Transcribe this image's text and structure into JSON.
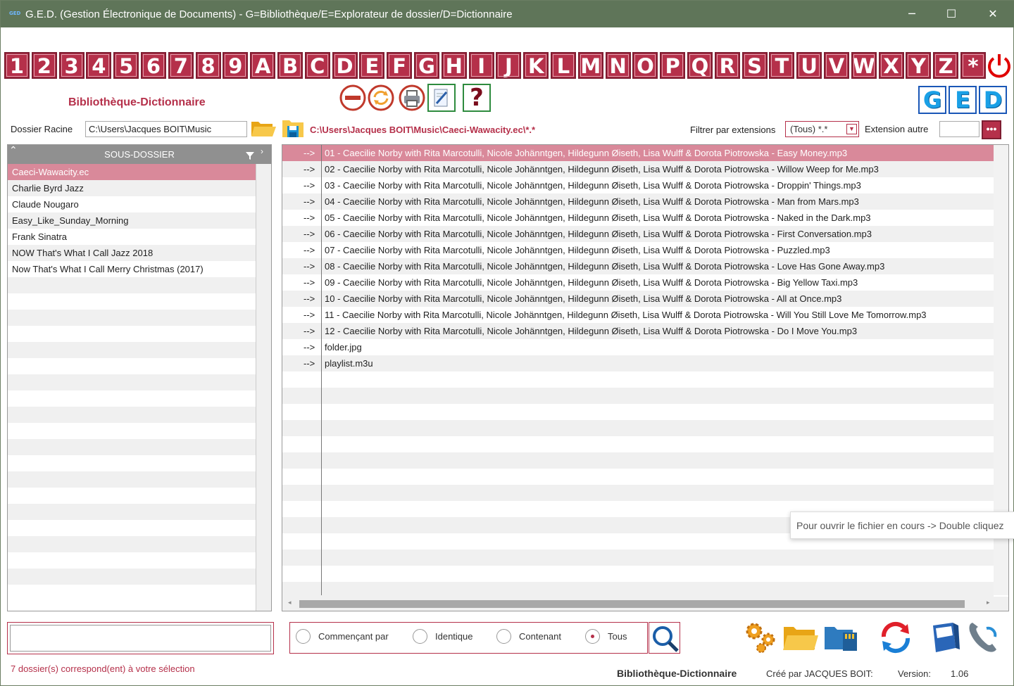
{
  "window": {
    "title": "G.E.D. (Gestion Électronique de Documents) - G=Bibliothèque/E=Explorateur de dossier/D=Dictionnaire",
    "app_icon_text": "GED",
    "minimize": "─",
    "maximize": "☐",
    "close": "✕"
  },
  "letters": [
    "1",
    "2",
    "3",
    "4",
    "5",
    "6",
    "7",
    "8",
    "9",
    "A",
    "B",
    "C",
    "D",
    "E",
    "F",
    "G",
    "H",
    "I",
    "J",
    "K",
    "L",
    "M",
    "N",
    "O",
    "P",
    "Q",
    "R",
    "S",
    "T",
    "U",
    "V",
    "W",
    "X",
    "Y",
    "Z",
    "*"
  ],
  "toolbar": {
    "section_title": "Bibliothèque-Dictionnaire",
    "help_label": "?",
    "ged": [
      "G",
      "E",
      "D"
    ]
  },
  "racine": {
    "label": "Dossier Racine",
    "value": "C:\\Users\\Jacques BOIT\\Music",
    "current_path": "C:\\Users\\Jacques BOIT\\Music\\Caeci-Wawacity.ec\\*.*"
  },
  "filter": {
    "label": "Filtrer par extensions",
    "selected": "(Tous) *.*",
    "other_label": "Extension autre",
    "other_value": "",
    "more_label": "•••"
  },
  "left": {
    "header": "SOUS-DOSSIER",
    "folders": [
      "Caeci-Wawacity.ec",
      "Charlie Byrd Jazz",
      "Claude Nougaro",
      "Easy_Like_Sunday_Morning",
      "Frank Sinatra",
      "NOW That's What I Call Jazz 2018",
      "Now That's What I Call Merry Christmas (2017)"
    ],
    "selected_index": 0
  },
  "files": {
    "arrow": "-->",
    "items": [
      "01 - Caecilie Norby with Rita Marcotulli, Nicole Johänntgen, Hildegunn Øiseth, Lisa Wulff & Dorota Piotrowska - Easy Money.mp3",
      "02 - Caecilie Norby with Rita Marcotulli, Nicole Johänntgen, Hildegunn Øiseth, Lisa Wulff & Dorota Piotrowska - Willow Weep for Me.mp3",
      "03 - Caecilie Norby with Rita Marcotulli, Nicole Johänntgen, Hildegunn Øiseth, Lisa Wulff & Dorota Piotrowska - Droppin' Things.mp3",
      "04 - Caecilie Norby with Rita Marcotulli, Nicole Johänntgen, Hildegunn Øiseth, Lisa Wulff & Dorota Piotrowska - Man from Mars.mp3",
      "05 - Caecilie Norby with Rita Marcotulli, Nicole Johänntgen, Hildegunn Øiseth, Lisa Wulff & Dorota Piotrowska - Naked in the Dark.mp3",
      "06 - Caecilie Norby with Rita Marcotulli, Nicole Johänntgen, Hildegunn Øiseth, Lisa Wulff & Dorota Piotrowska - First Conversation.mp3",
      "07 - Caecilie Norby with Rita Marcotulli, Nicole Johänntgen, Hildegunn Øiseth, Lisa Wulff & Dorota Piotrowska - Puzzled.mp3",
      "08 - Caecilie Norby with Rita Marcotulli, Nicole Johänntgen, Hildegunn Øiseth, Lisa Wulff & Dorota Piotrowska - Love Has Gone Away.mp3",
      "09 - Caecilie Norby with Rita Marcotulli, Nicole Johänntgen, Hildegunn Øiseth, Lisa Wulff & Dorota Piotrowska - Big Yellow Taxi.mp3",
      "10 - Caecilie Norby with Rita Marcotulli, Nicole Johänntgen, Hildegunn Øiseth, Lisa Wulff & Dorota Piotrowska - All at Once.mp3",
      "11 - Caecilie Norby with Rita Marcotulli, Nicole Johänntgen, Hildegunn Øiseth, Lisa Wulff & Dorota Piotrowska - Will You Still Love Me Tomorrow.mp3",
      "12 - Caecilie Norby with Rita Marcotulli, Nicole Johänntgen, Hildegunn Øiseth, Lisa Wulff & Dorota Piotrowska - Do I Move You.mp3",
      "folder.jpg",
      "playlist.m3u"
    ],
    "selected_index": 0
  },
  "tooltip": "Pour ouvrir le fichier en cours -> Double cliquez",
  "search": {
    "value": "",
    "options": [
      "Commençant par",
      "Identique",
      "Contenant",
      "Tous"
    ],
    "selected_index": 3
  },
  "status": "7 dossier(s) correspond(ent) à votre sélection",
  "footer": {
    "title": "Bibliothèque-Dictionnaire",
    "by": "Créé par JACQUES BOIT:",
    "version_label": "Version:",
    "version": "1.06"
  },
  "colors": {
    "accent": "#b5304a",
    "titlebar": "#5f7559",
    "selected_row": "#d9899a",
    "ged_blue": "#1aa0e6"
  }
}
